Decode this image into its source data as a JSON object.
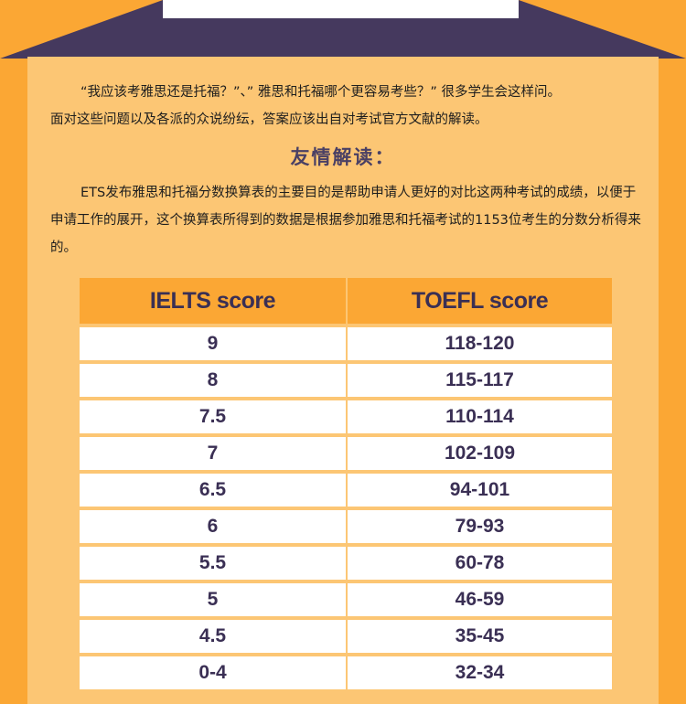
{
  "intro": {
    "line1": "“我应该考雅思还是托福？”、” 雅思和托福哪个更容易考些？” 很多学生会这样问。",
    "line2": "面对这些问题以及各派的众说纷纭，答案应该出自对考试官方文献的解读。"
  },
  "subtitle": "友情解读：",
  "description": "ETS发布雅思和托福分数换算表的主要目的是帮助申请人更好的对比这两种考试的成绩，以便于申请工作的展开，这个换算表所得到的数据是根据参加雅思和托福考试的1153位考生的分数分析得来的。",
  "table": {
    "headers": [
      "IELTS score",
      "TOEFL score"
    ],
    "rows": [
      [
        "9",
        "118-120"
      ],
      [
        "8",
        "115-117"
      ],
      [
        "7.5",
        "110-114"
      ],
      [
        "7",
        "102-109"
      ],
      [
        "6.5",
        "94-101"
      ],
      [
        "6",
        "79-93"
      ],
      [
        "5.5",
        "60-78"
      ],
      [
        "5",
        "46-59"
      ],
      [
        "4.5",
        "35-45"
      ],
      [
        "0-4",
        "32-34"
      ]
    ]
  }
}
